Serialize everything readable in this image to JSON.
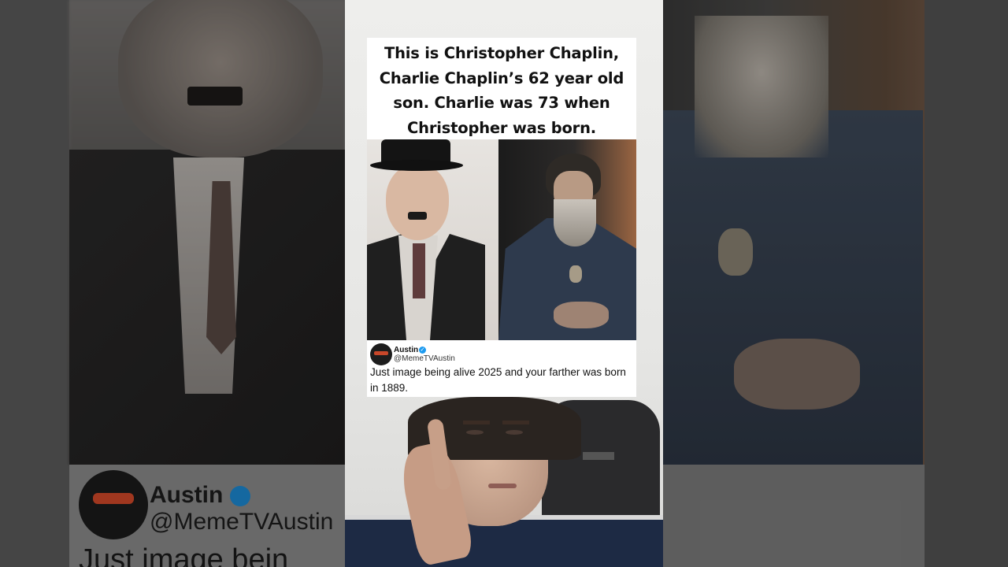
{
  "meme": {
    "headline": "This is Christopher Chaplin, Charlie Chaplin’s 62 year old son. Charlie was 73 when Christopher was born.",
    "left_photo": "Charlie Chaplin",
    "right_photo": "Christopher Chaplin"
  },
  "tweet": {
    "name": "Austin",
    "handle": "@MemeTVAustin",
    "verified": true,
    "text": "Just image being alive 2025 and your farther was born in 1889."
  },
  "background_left": {
    "name": "Austin",
    "handle": "@MemeTVAustin",
    "text_fragment": "Just image bein"
  },
  "colors": {
    "verified_badge": "#1d9bf0",
    "card_bg": "#ffffff"
  }
}
